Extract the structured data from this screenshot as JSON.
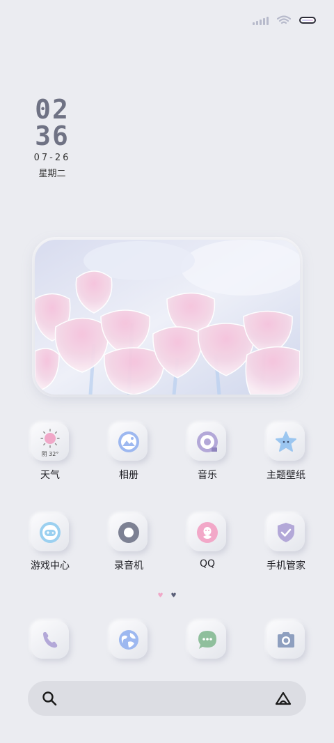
{
  "clock": {
    "hour": "02",
    "minute": "36",
    "date": "07-26",
    "weekday": "星期二"
  },
  "weather": {
    "temp": "阴 32°"
  },
  "apps_row1": [
    {
      "label": "天气",
      "icon": "weather-sun-icon"
    },
    {
      "label": "相册",
      "icon": "gallery-icon"
    },
    {
      "label": "音乐",
      "icon": "music-disc-icon"
    },
    {
      "label": "主题壁纸",
      "icon": "theme-star-icon"
    }
  ],
  "apps_row2": [
    {
      "label": "游戏中心",
      "icon": "gamepad-icon"
    },
    {
      "label": "录音机",
      "icon": "recorder-icon"
    },
    {
      "label": "QQ",
      "icon": "qq-penguin-icon"
    },
    {
      "label": "手机管家",
      "icon": "shield-check-icon"
    }
  ],
  "dock": [
    {
      "icon": "phone-icon"
    },
    {
      "icon": "browser-globe-icon"
    },
    {
      "icon": "messages-icon"
    },
    {
      "icon": "camera-icon"
    }
  ],
  "page_dots": {
    "active": "♥",
    "inactive": "♥"
  },
  "colors": {
    "background": "#ebecf1",
    "accent_pink": "#f0a8c8",
    "accent_blue": "#9db8f0",
    "accent_purple": "#b3a8d8"
  }
}
